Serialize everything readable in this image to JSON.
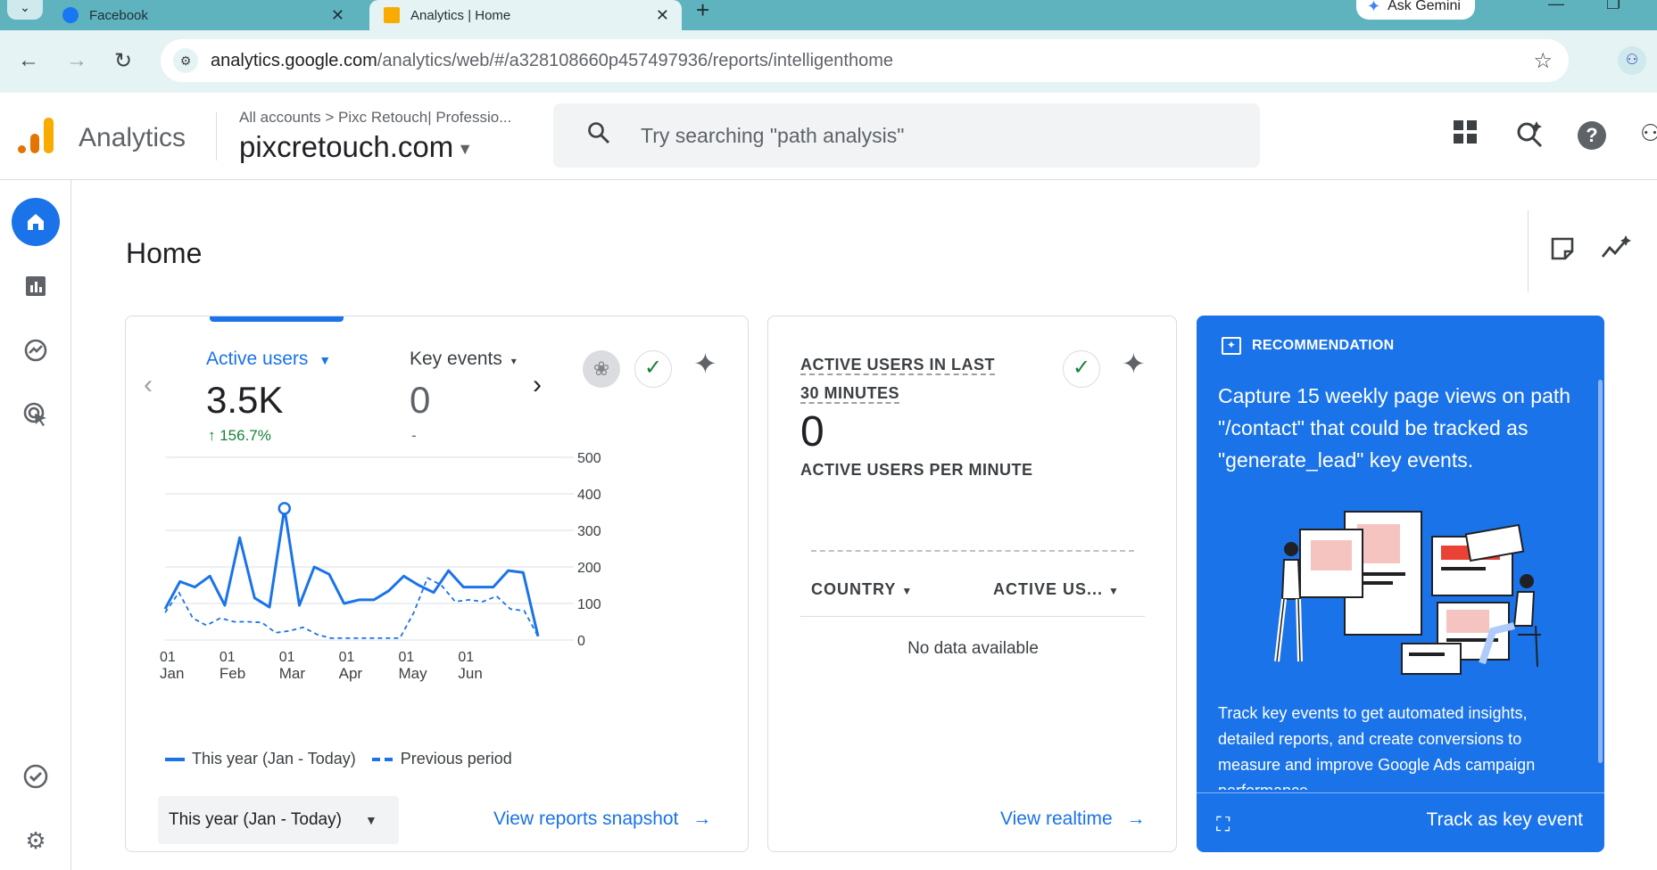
{
  "browser": {
    "tabs": [
      {
        "title": "Facebook",
        "favicon_color": "#1877f2"
      },
      {
        "title": "Analytics | Home",
        "favicon_color": "#f9ab00"
      }
    ],
    "gemini_label": "Ask Gemini",
    "url_host": "analytics.google.com",
    "url_path": "/analytics/web/#/a328108660p457497936/reports/intelligenthome"
  },
  "header": {
    "app_name": "Analytics",
    "breadcrumb": "All accounts  >  Pixc Retouch| Professio...",
    "property": "pixcretouch.com",
    "search_placeholder": "Try searching \"path analysis\""
  },
  "page": {
    "title": "Home"
  },
  "card_overview": {
    "metric1_label": "Active users",
    "metric1_value": "3.5K",
    "metric1_change": "↑ 156.7%",
    "metric2_label": "Key events",
    "metric2_value": "0",
    "metric2_sub": "-",
    "legend_this": "This year (Jan - Today)",
    "legend_prev": "Previous period",
    "date_range": "This year (Jan - Today)",
    "link": "View reports snapshot"
  },
  "chart_data": {
    "type": "line",
    "y_ticks": [
      "500",
      "400",
      "300",
      "200",
      "100",
      "0"
    ],
    "ylim": [
      0,
      500
    ],
    "x_ticks": [
      {
        "day": "01",
        "month": "Jan",
        "index": 0
      },
      {
        "day": "01",
        "month": "Feb",
        "index": 4
      },
      {
        "day": "01",
        "month": "Mar",
        "index": 8
      },
      {
        "day": "01",
        "month": "Apr",
        "index": 12
      },
      {
        "day": "01",
        "month": "May",
        "index": 16
      },
      {
        "day": "01",
        "month": "Jun",
        "index": 20
      }
    ],
    "series": [
      {
        "name": "This year (Jan - Today)",
        "style": "solid",
        "color": "#1a73e8",
        "values": [
          85,
          160,
          145,
          175,
          95,
          280,
          115,
          90,
          360,
          95,
          200,
          180,
          100,
          110,
          110,
          135,
          175,
          150,
          130,
          190,
          145,
          145,
          145,
          190,
          185,
          10
        ],
        "highlight_index": 8
      },
      {
        "name": "Previous period",
        "style": "dashed",
        "color": "#1a73e8",
        "values": [
          75,
          130,
          60,
          40,
          60,
          50,
          50,
          48,
          20,
          25,
          35,
          15,
          5,
          5,
          5,
          5,
          5,
          5,
          75,
          170,
          150,
          105,
          110,
          105,
          120,
          85,
          80,
          10
        ]
      }
    ]
  },
  "card_realtime": {
    "title": "ACTIVE USERS IN LAST 30 MINUTES",
    "value": "0",
    "sub": "ACTIVE USERS PER MINUTE",
    "col1": "COUNTRY",
    "col2": "ACTIVE US...",
    "empty": "No data available",
    "link": "View realtime"
  },
  "card_recommendation": {
    "label": "RECOMMENDATION",
    "body": "Capture 15 weekly page views on path \"/contact\" that could be tracked as \"generate_lead\" key events.",
    "description": "Track key events to get automated insights, detailed reports, and create conversions to measure and improve Google Ads campaign performance.",
    "action": "Track as key event",
    "bg_color": "#1a73e8"
  }
}
